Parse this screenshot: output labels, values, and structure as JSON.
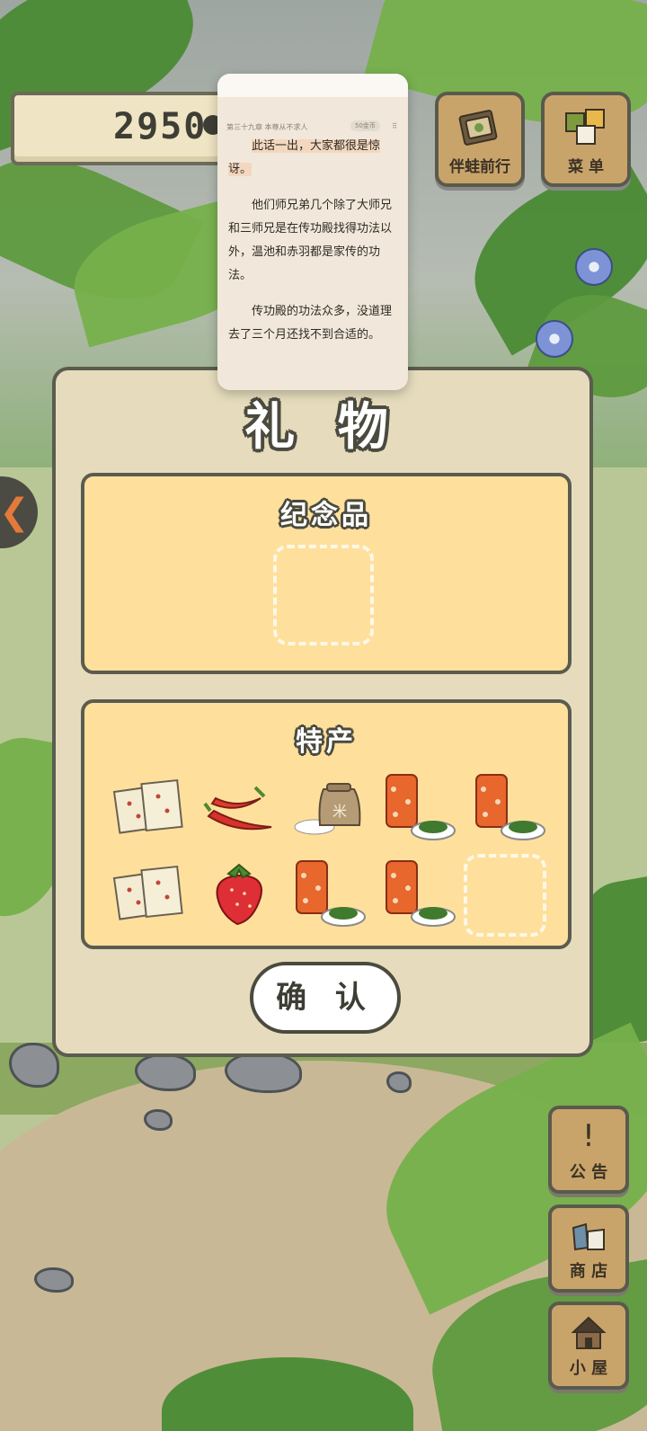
{
  "hud": {
    "clover_count": "2950",
    "travel_button_label": "伴蛙前行",
    "menu_button_label": "菜 单"
  },
  "side_buttons": {
    "notice_label": "公 告",
    "shop_label": "商 店",
    "house_label": "小 屋"
  },
  "gift_dialog": {
    "title": "礼 物",
    "souvenir_section_title": "纪念品",
    "specialty_section_title": "特产",
    "specialty_items": [
      {
        "icon": "rice-cake-icon"
      },
      {
        "icon": "chili-pepper-icon"
      },
      {
        "icon": "rice-sack-icon"
      },
      {
        "icon": "tea-can-icon"
      },
      {
        "icon": "tea-can-icon"
      },
      {
        "icon": "rice-cake-icon"
      },
      {
        "icon": "strawberry-icon"
      },
      {
        "icon": "tea-can-icon"
      },
      {
        "icon": "tea-can-icon"
      }
    ],
    "confirm_label": "确 认"
  },
  "reader": {
    "chapter_title": "第三十九章 本尊从不求人",
    "coins_badge": "50金币",
    "more_glyph": "⠿",
    "paragraph_1": "此话一出，大家都很是惊讶。",
    "paragraph_2": "他们师兄弟几个除了大师兄和三师兄是在传功殿找得功法以外，温池和赤羽都是家传的功法。",
    "paragraph_3": "传功殿的功法众多，没道理去了三个月还找不到合适的。"
  },
  "colors": {
    "dialog_bg": "#e6dcbd",
    "section_bg": "#fee09c",
    "outline": "#5b5c4f",
    "button_wood": "#c9a46a"
  }
}
